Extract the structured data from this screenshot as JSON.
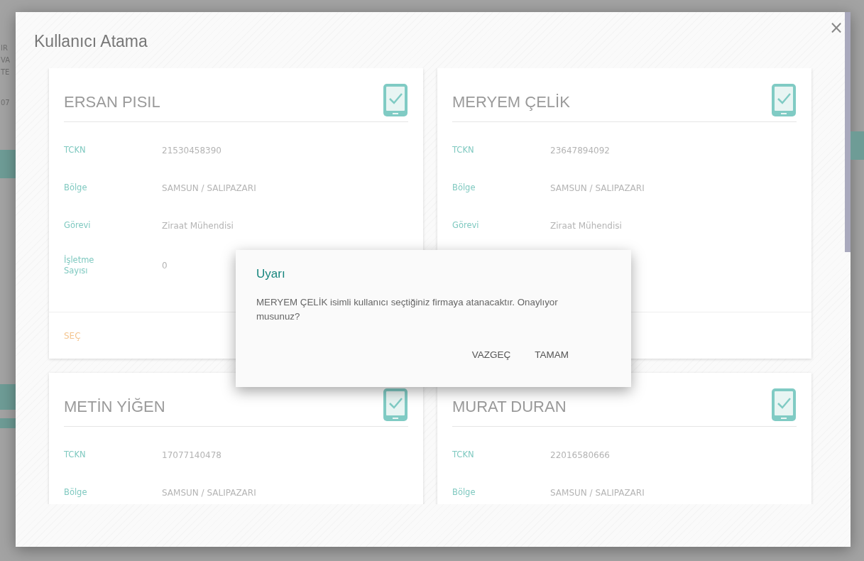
{
  "background": {
    "fragments": [
      "IR",
      "VA",
      "TE",
      "07"
    ]
  },
  "modal": {
    "title": "Kullanıcı Atama",
    "close": "×"
  },
  "cards": [
    {
      "name": "ERSAN PISIL",
      "fields": [
        {
          "label": "TCKN",
          "value": "21530458390"
        },
        {
          "label": "Bölge",
          "value": "SAMSUN / SALIPAZARI"
        },
        {
          "label": "Görevi",
          "value": "Ziraat Mühendisi"
        },
        {
          "label": "İşletme Sayısı",
          "value": "0"
        }
      ],
      "select_label": "SEÇ"
    },
    {
      "name": "MERYEM ÇELİK",
      "fields": [
        {
          "label": "TCKN",
          "value": "23647894092"
        },
        {
          "label": "Bölge",
          "value": "SAMSUN / SALIPAZARI"
        },
        {
          "label": "Görevi",
          "value": "Ziraat Mühendisi"
        }
      ]
    },
    {
      "name": "METİN YİĞEN",
      "fields": [
        {
          "label": "TCKN",
          "value": "17077140478"
        },
        {
          "label": "Bölge",
          "value": "SAMSUN / SALIPAZARI"
        }
      ]
    },
    {
      "name": "MURAT DURAN",
      "fields": [
        {
          "label": "TCKN",
          "value": "22016580666"
        },
        {
          "label": "Bölge",
          "value": "SAMSUN / SALIPAZARI"
        }
      ]
    }
  ],
  "dialog": {
    "title": "Uyarı",
    "message": "MERYEM ÇELİK isimli kullanıcı seçtiğiniz firmaya atanacaktır. Onaylıyor musunuz?",
    "buttons": [
      "VAZGEÇ",
      "TAMAM"
    ]
  }
}
